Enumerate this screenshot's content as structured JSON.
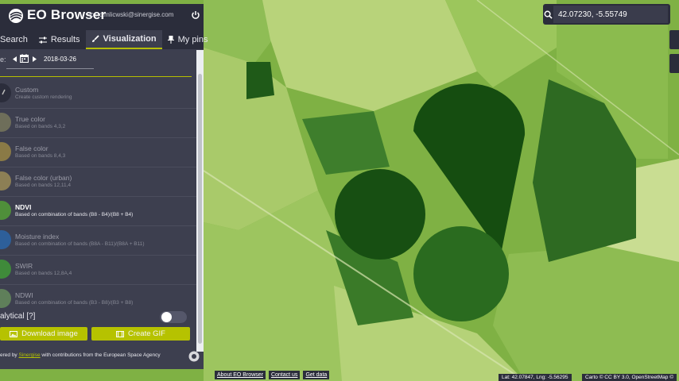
{
  "app": {
    "title": "EO Browser",
    "user_email": "lo...c.mlicwski@sinergise.com"
  },
  "search_box": {
    "value": "42.07230, -5.55749",
    "icon": "search-icon"
  },
  "tabs": [
    {
      "label": "Search",
      "icon": "search-icon",
      "active": false
    },
    {
      "label": "Results",
      "icon": "sliders-icon",
      "active": false
    },
    {
      "label": "Visualization",
      "icon": "brush-icon",
      "active": true
    },
    {
      "label": "My pins",
      "icon": "pin-icon",
      "active": false
    }
  ],
  "date": {
    "label": "e:",
    "value": "2018-03-26"
  },
  "layers": [
    {
      "name": "Custom",
      "desc": "Create custom rendering",
      "active": false
    },
    {
      "name": "True color",
      "desc": "Based on bands 4,3,2",
      "active": false
    },
    {
      "name": "False color",
      "desc": "Based on bands 8,4,3",
      "active": false
    },
    {
      "name": "False color (urban)",
      "desc": "Based on bands 12,11,4",
      "active": false
    },
    {
      "name": "NDVI",
      "desc": "Based on combination of bands (B8 - B4)/(B8 + B4)",
      "active": true
    },
    {
      "name": "Moisture index",
      "desc": "Based on combination of bands (B8A - B11)/(B8A + B11)",
      "active": false
    },
    {
      "name": "SWIR",
      "desc": "Based on bands 12,8A,4",
      "active": false
    },
    {
      "name": "NDWI",
      "desc": "Based on combination of bands (B3 - B8)/(B3 + B8)",
      "active": false
    }
  ],
  "analytical": {
    "label": "alytical [?]",
    "enabled": false
  },
  "buttons": {
    "download": "Download image",
    "gif": "Create GIF"
  },
  "credits": {
    "prefix": "ered by ",
    "link": "Sinergise",
    "suffix": " with contributions from the European Space Agency"
  },
  "footer": {
    "links": [
      "About EO Browser",
      "Contact us",
      "Get data"
    ],
    "coords": "Lat: 42.07847, Lng: -5.56295",
    "attribution": "Carto © CC BY 3.0, OpenStreetMap ©"
  },
  "colors": {
    "accent": "#b6c200",
    "panel": "#3d3f4f",
    "panel_dark": "#2b2d3b"
  }
}
